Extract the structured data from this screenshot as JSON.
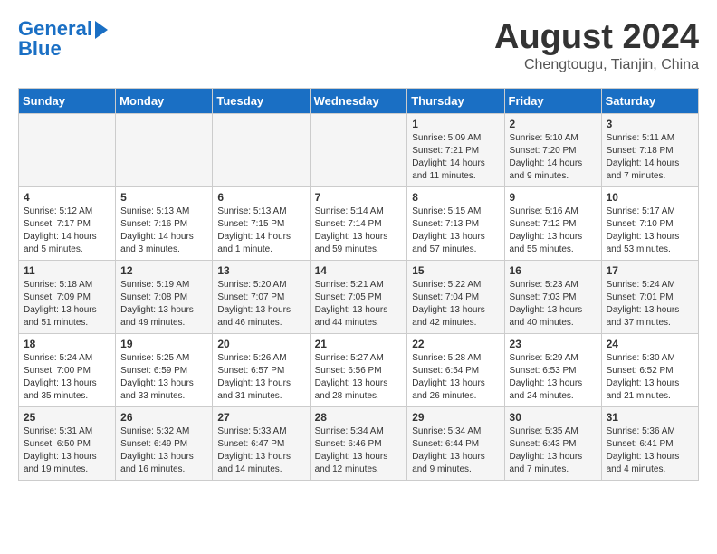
{
  "logo": {
    "line1": "General",
    "line2": "Blue"
  },
  "title": "August 2024",
  "location": "Chengtougu, Tianjin, China",
  "days_of_week": [
    "Sunday",
    "Monday",
    "Tuesday",
    "Wednesday",
    "Thursday",
    "Friday",
    "Saturday"
  ],
  "weeks": [
    [
      {
        "day": "",
        "info": ""
      },
      {
        "day": "",
        "info": ""
      },
      {
        "day": "",
        "info": ""
      },
      {
        "day": "",
        "info": ""
      },
      {
        "day": "1",
        "info": "Sunrise: 5:09 AM\nSunset: 7:21 PM\nDaylight: 14 hours\nand 11 minutes."
      },
      {
        "day": "2",
        "info": "Sunrise: 5:10 AM\nSunset: 7:20 PM\nDaylight: 14 hours\nand 9 minutes."
      },
      {
        "day": "3",
        "info": "Sunrise: 5:11 AM\nSunset: 7:18 PM\nDaylight: 14 hours\nand 7 minutes."
      }
    ],
    [
      {
        "day": "4",
        "info": "Sunrise: 5:12 AM\nSunset: 7:17 PM\nDaylight: 14 hours\nand 5 minutes."
      },
      {
        "day": "5",
        "info": "Sunrise: 5:13 AM\nSunset: 7:16 PM\nDaylight: 14 hours\nand 3 minutes."
      },
      {
        "day": "6",
        "info": "Sunrise: 5:13 AM\nSunset: 7:15 PM\nDaylight: 14 hours\nand 1 minute."
      },
      {
        "day": "7",
        "info": "Sunrise: 5:14 AM\nSunset: 7:14 PM\nDaylight: 13 hours\nand 59 minutes."
      },
      {
        "day": "8",
        "info": "Sunrise: 5:15 AM\nSunset: 7:13 PM\nDaylight: 13 hours\nand 57 minutes."
      },
      {
        "day": "9",
        "info": "Sunrise: 5:16 AM\nSunset: 7:12 PM\nDaylight: 13 hours\nand 55 minutes."
      },
      {
        "day": "10",
        "info": "Sunrise: 5:17 AM\nSunset: 7:10 PM\nDaylight: 13 hours\nand 53 minutes."
      }
    ],
    [
      {
        "day": "11",
        "info": "Sunrise: 5:18 AM\nSunset: 7:09 PM\nDaylight: 13 hours\nand 51 minutes."
      },
      {
        "day": "12",
        "info": "Sunrise: 5:19 AM\nSunset: 7:08 PM\nDaylight: 13 hours\nand 49 minutes."
      },
      {
        "day": "13",
        "info": "Sunrise: 5:20 AM\nSunset: 7:07 PM\nDaylight: 13 hours\nand 46 minutes."
      },
      {
        "day": "14",
        "info": "Sunrise: 5:21 AM\nSunset: 7:05 PM\nDaylight: 13 hours\nand 44 minutes."
      },
      {
        "day": "15",
        "info": "Sunrise: 5:22 AM\nSunset: 7:04 PM\nDaylight: 13 hours\nand 42 minutes."
      },
      {
        "day": "16",
        "info": "Sunrise: 5:23 AM\nSunset: 7:03 PM\nDaylight: 13 hours\nand 40 minutes."
      },
      {
        "day": "17",
        "info": "Sunrise: 5:24 AM\nSunset: 7:01 PM\nDaylight: 13 hours\nand 37 minutes."
      }
    ],
    [
      {
        "day": "18",
        "info": "Sunrise: 5:24 AM\nSunset: 7:00 PM\nDaylight: 13 hours\nand 35 minutes."
      },
      {
        "day": "19",
        "info": "Sunrise: 5:25 AM\nSunset: 6:59 PM\nDaylight: 13 hours\nand 33 minutes."
      },
      {
        "day": "20",
        "info": "Sunrise: 5:26 AM\nSunset: 6:57 PM\nDaylight: 13 hours\nand 31 minutes."
      },
      {
        "day": "21",
        "info": "Sunrise: 5:27 AM\nSunset: 6:56 PM\nDaylight: 13 hours\nand 28 minutes."
      },
      {
        "day": "22",
        "info": "Sunrise: 5:28 AM\nSunset: 6:54 PM\nDaylight: 13 hours\nand 26 minutes."
      },
      {
        "day": "23",
        "info": "Sunrise: 5:29 AM\nSunset: 6:53 PM\nDaylight: 13 hours\nand 24 minutes."
      },
      {
        "day": "24",
        "info": "Sunrise: 5:30 AM\nSunset: 6:52 PM\nDaylight: 13 hours\nand 21 minutes."
      }
    ],
    [
      {
        "day": "25",
        "info": "Sunrise: 5:31 AM\nSunset: 6:50 PM\nDaylight: 13 hours\nand 19 minutes."
      },
      {
        "day": "26",
        "info": "Sunrise: 5:32 AM\nSunset: 6:49 PM\nDaylight: 13 hours\nand 16 minutes."
      },
      {
        "day": "27",
        "info": "Sunrise: 5:33 AM\nSunset: 6:47 PM\nDaylight: 13 hours\nand 14 minutes."
      },
      {
        "day": "28",
        "info": "Sunrise: 5:34 AM\nSunset: 6:46 PM\nDaylight: 13 hours\nand 12 minutes."
      },
      {
        "day": "29",
        "info": "Sunrise: 5:34 AM\nSunset: 6:44 PM\nDaylight: 13 hours\nand 9 minutes."
      },
      {
        "day": "30",
        "info": "Sunrise: 5:35 AM\nSunset: 6:43 PM\nDaylight: 13 hours\nand 7 minutes."
      },
      {
        "day": "31",
        "info": "Sunrise: 5:36 AM\nSunset: 6:41 PM\nDaylight: 13 hours\nand 4 minutes."
      }
    ]
  ]
}
